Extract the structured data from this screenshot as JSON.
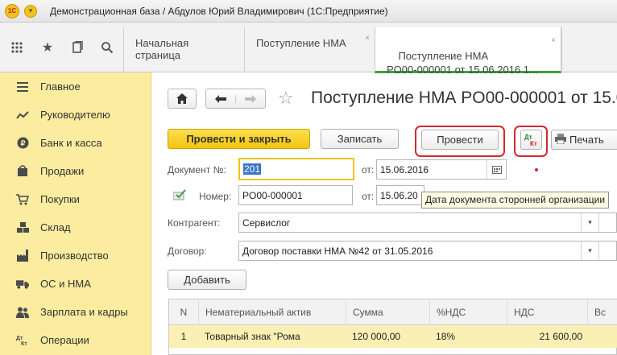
{
  "window": {
    "title": "Демонстрационная база / Абдулов Юрий Владимирович (1С:Предприятие)",
    "logo_text": "1С"
  },
  "tabs": [
    {
      "label": "Начальная страница"
    },
    {
      "label": "Поступление НМА"
    },
    {
      "label": "Поступление НМА\nPO00-000001 от 15.06.2016 1..."
    }
  ],
  "tab_close_symbol": "×",
  "sidebar": {
    "items": [
      {
        "label": "Главное",
        "icon": "menu-lines-icon"
      },
      {
        "label": "Руководителю",
        "icon": "trend-icon"
      },
      {
        "label": "Банк и касса",
        "icon": "ruble-coin-icon"
      },
      {
        "label": "Продажи",
        "icon": "shopping-bag-icon"
      },
      {
        "label": "Покупки",
        "icon": "shopping-cart-icon"
      },
      {
        "label": "Склад",
        "icon": "warehouse-icon"
      },
      {
        "label": "Производство",
        "icon": "factory-icon"
      },
      {
        "label": "ОС и НМА",
        "icon": "truck-icon"
      },
      {
        "label": "Зарплата и кадры",
        "icon": "people-icon"
      },
      {
        "label": "Операции",
        "icon": "dt-kt-icon"
      }
    ]
  },
  "document": {
    "title": "Поступление НМА PO00-000001 от 15.0",
    "buttons": {
      "post_and_close": "Провести и закрыть",
      "save": "Записать",
      "post": "Провести",
      "dtkt": "Дт Кт",
      "print": "Печать",
      "add": "Добавить"
    },
    "doc_number_label": "Документ №:",
    "doc_number_value": "201",
    "from_label": "от:",
    "doc_date": "15.06.2016",
    "number_label": "Номер:",
    "number_value": "PO00-000001",
    "from_label2": "от:",
    "date2": "15.06.20",
    "tooltip": "Дата документа сторонней организации",
    "counterparty_label": "Контрагент:",
    "counterparty_value": "Сервислог",
    "contract_label": "Договор:",
    "contract_value": "Договор поставки НМА №42 от 31.05.2016"
  },
  "table": {
    "headers": [
      "N",
      "Нематериальный актив",
      "Сумма",
      "%НДС",
      "НДС",
      "Вс"
    ],
    "rows": [
      {
        "n": "1",
        "asset": "Товарный знак \"Рома",
        "sum": "120 000,00",
        "vat_rate": "18%",
        "vat": "21 600,00"
      }
    ]
  },
  "colors": {
    "sidebar_bg": "#fbeca0",
    "primary_button": "#f2c40f",
    "highlight_ring": "#d2282e",
    "active_tab_underline": "#3aa33a",
    "selected_row": "#fbf0b4"
  }
}
